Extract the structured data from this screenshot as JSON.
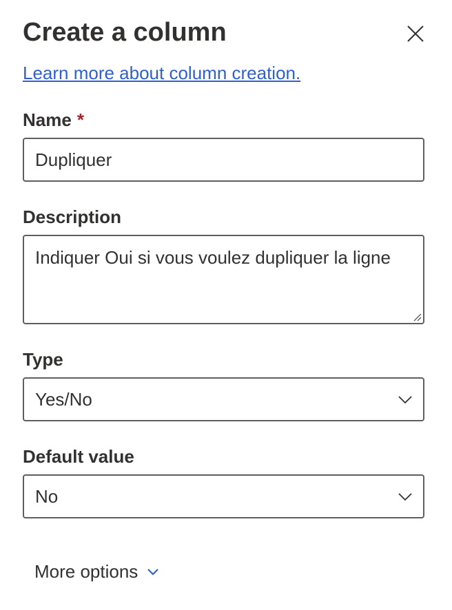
{
  "panel": {
    "title": "Create a column",
    "learn_more_link": "Learn more about column creation."
  },
  "name_field": {
    "label": "Name",
    "required_marker": "*",
    "value": "Dupliquer"
  },
  "description_field": {
    "label": "Description",
    "value": "Indiquer Oui si vous voulez dupliquer la ligne"
  },
  "type_field": {
    "label": "Type",
    "selected": "Yes/No"
  },
  "default_value_field": {
    "label": "Default value",
    "selected": "No"
  },
  "more_options": {
    "label": "More options"
  },
  "icons": {
    "close": "close-icon",
    "dropdown": "chevron-down-icon",
    "more_options": "chevron-down-icon"
  },
  "colors": {
    "link": "#2f5fd0",
    "required": "#a4262c",
    "accent": "#2f5fd0",
    "border": "#605e5c",
    "text": "#323130"
  }
}
